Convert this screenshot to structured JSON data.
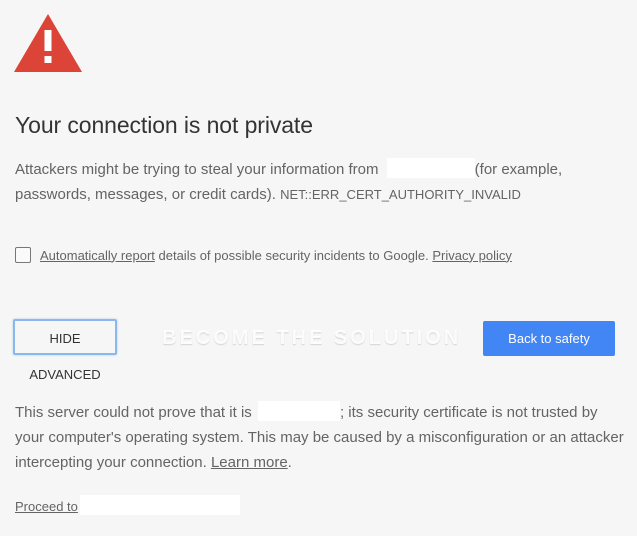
{
  "icons": {
    "warning": "warning-triangle-icon",
    "warning_color": "#db4437"
  },
  "heading": "Your connection is not private",
  "intro": {
    "before_site": "Attackers might be trying to steal your information from ",
    "after_site": "(for example, passwords, messages, or credit cards). ",
    "error_code": "NET::ERR_CERT_AUTHORITY_INVALID"
  },
  "report": {
    "checked": false,
    "link_label": "Automatically report",
    "text": " details of possible security incidents to Google. ",
    "privacy_label": "Privacy policy"
  },
  "buttons": {
    "hide_advanced": "HIDE ADVANCED",
    "back_to_safety": "Back to safety",
    "primary_color": "#4285f4"
  },
  "watermark": "BECOME THE SOLUTION",
  "details": {
    "before_site": "This server could not prove that it is ",
    "after_site": "; its security certificate is not trusted by your computer's operating system. This may be caused by a misconfiguration or an attacker intercepting your connection. ",
    "learn_more": "Learn more",
    "period": "."
  },
  "proceed": {
    "label": "Proceed to"
  }
}
